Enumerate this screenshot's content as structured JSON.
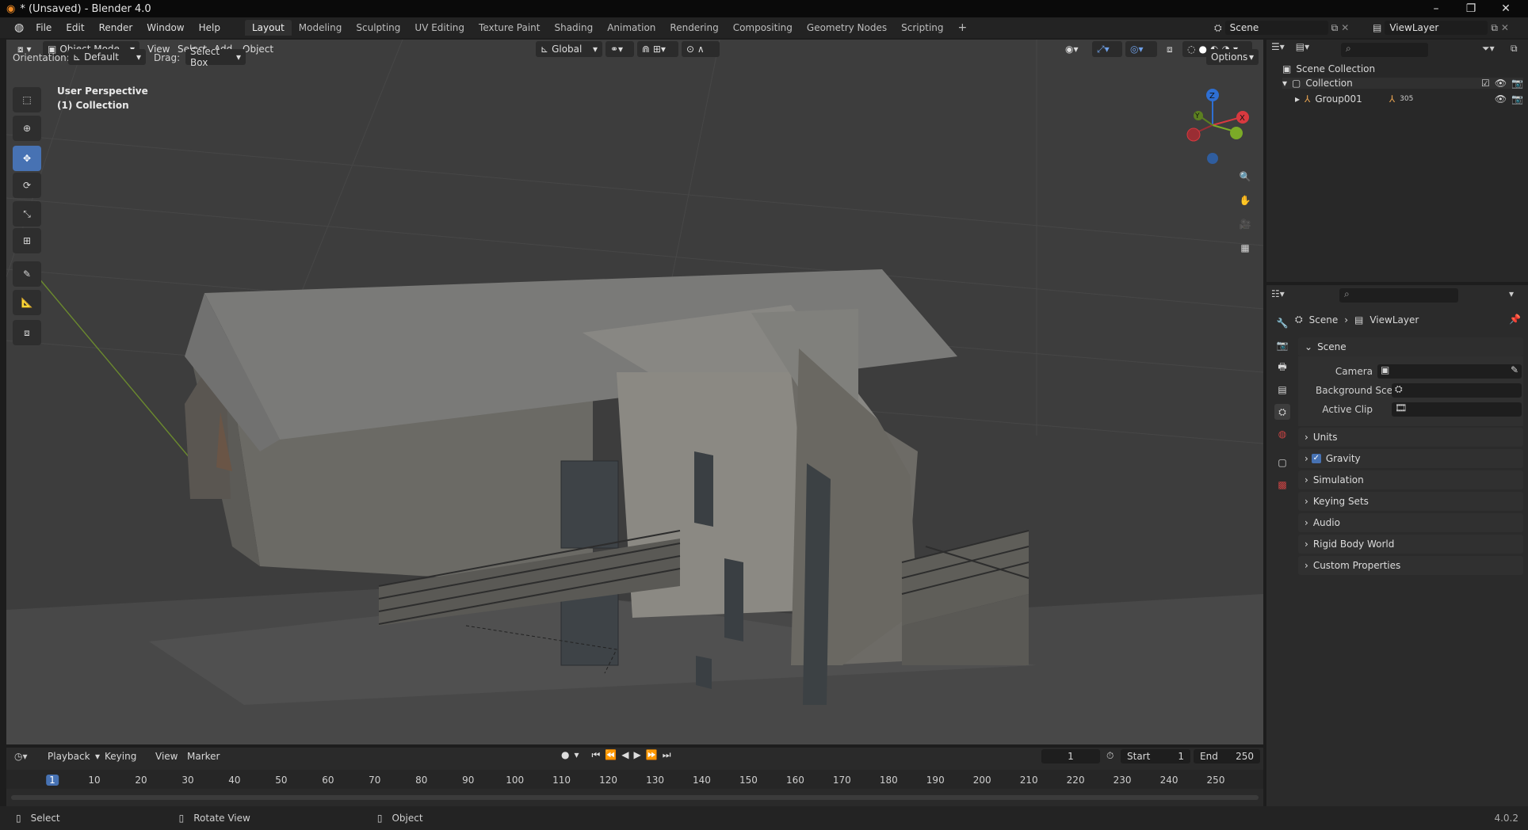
{
  "window": {
    "title": "* (Unsaved) - Blender 4.0",
    "minimize": "–",
    "maximize": "❐",
    "close": "✕"
  },
  "menu": [
    "File",
    "Edit",
    "Render",
    "Window",
    "Help"
  ],
  "workspaces": [
    "Layout",
    "Modeling",
    "Sculpting",
    "UV Editing",
    "Texture Paint",
    "Shading",
    "Animation",
    "Rendering",
    "Compositing",
    "Geometry Nodes",
    "Scripting"
  ],
  "workspace_add": "+",
  "scene_selector": "Scene",
  "viewlayer_selector": "ViewLayer",
  "viewport_header": {
    "mode": "Object Mode",
    "menus": [
      "View",
      "Select",
      "Add",
      "Object"
    ],
    "transform_orientation": "Global",
    "orientation_label": "Orientation:",
    "orientation_value": "Default",
    "drag_label": "Drag:",
    "drag_value": "Select Box",
    "options": "Options"
  },
  "viewport_overlay": {
    "perspective": "User Perspective",
    "collection": "(1) Collection"
  },
  "gizmo": {
    "z": "Z",
    "y": "Y",
    "x": "X"
  },
  "outliner": {
    "root": "Scene Collection",
    "collection": "Collection",
    "object": "Group001",
    "object_count": "305"
  },
  "properties": {
    "breadcrumb_scene": "Scene",
    "breadcrumb_sep": "›",
    "breadcrumb_viewlayer": "ViewLayer",
    "section": "Scene",
    "camera_label": "Camera",
    "background_label": "Background Scene",
    "clip_label": "Active Clip",
    "panels": [
      "Units",
      "Gravity",
      "Simulation",
      "Keying Sets",
      "Audio",
      "Rigid Body World",
      "Custom Properties"
    ]
  },
  "timeline": {
    "menus": [
      "Playback",
      "Keying",
      "View",
      "Marker"
    ],
    "current_frame": "1",
    "start_label": "Start",
    "start_value": "1",
    "end_label": "End",
    "end_value": "250",
    "ticks": [
      "1",
      "10",
      "20",
      "30",
      "40",
      "50",
      "60",
      "70",
      "80",
      "90",
      "100",
      "110",
      "120",
      "130",
      "140",
      "150",
      "160",
      "170",
      "180",
      "190",
      "200",
      "210",
      "220",
      "230",
      "240",
      "250"
    ]
  },
  "statusbar": {
    "select": "Select",
    "rotate": "Rotate View",
    "object": "Object",
    "version": "4.0.2"
  },
  "colors": {
    "accent": "#4772b3",
    "x_axis": "#d8393f",
    "y_axis": "#7bab27",
    "z_axis": "#2e6fd3"
  }
}
